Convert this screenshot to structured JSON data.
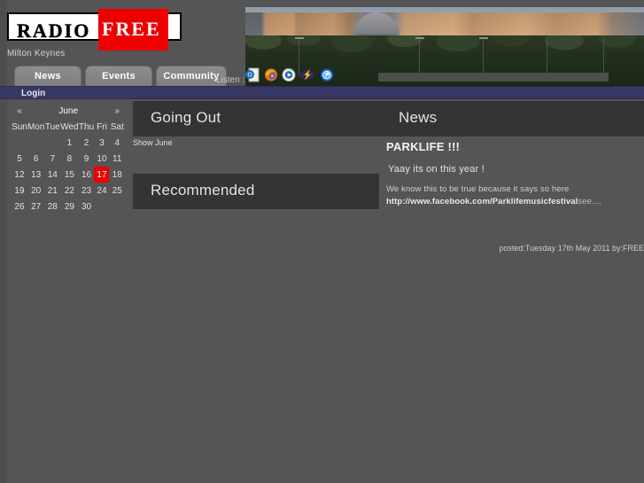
{
  "site": {
    "logo_primary": "RADIO",
    "logo_secondary": "FREE",
    "subtitle": "Milton Keynes",
    "banner_alt": "milton-keynes-skyline-photo"
  },
  "nav": {
    "tabs": [
      {
        "label": "News"
      },
      {
        "label": "Events"
      },
      {
        "label": "Community"
      }
    ],
    "listen_label": "Listen :",
    "listen_players": [
      {
        "name": "windows-media-player-icon"
      },
      {
        "name": "firefox-icon"
      },
      {
        "name": "media-player-icon"
      },
      {
        "name": "winamp-icon"
      },
      {
        "name": "realplayer-icon"
      }
    ],
    "login_label": "Login"
  },
  "calendar": {
    "prev": "«",
    "next": "»",
    "month": "June",
    "dow": [
      "Sun",
      "Mon",
      "Tue",
      "Wed",
      "Thu",
      "Fri",
      "Sat"
    ],
    "weeks": [
      [
        "",
        "",
        "",
        "1",
        "2",
        "3",
        "4"
      ],
      [
        "5",
        "6",
        "7",
        "8",
        "9",
        "10",
        "11"
      ],
      [
        "12",
        "13",
        "14",
        "15",
        "16",
        "17",
        "18"
      ],
      [
        "19",
        "20",
        "21",
        "22",
        "23",
        "24",
        "25"
      ],
      [
        "26",
        "27",
        "28",
        "29",
        "30",
        "",
        ""
      ]
    ],
    "today": "17",
    "today_color": "#ee0000"
  },
  "sections": {
    "going_out_title": "Going Out",
    "news_title": "News",
    "show_month_label": "Show June",
    "recommended_title": "Recommended"
  },
  "article": {
    "title": "PARKLIFE !!!",
    "subtitle": "Yaay its on this year !",
    "body_line1": "We know this to be true because it says so here",
    "link": "http://www.facebook.com/Parklifemusicfestival",
    "more": "see....",
    "posted": "posted:Tuesday 17th May 2011 by:FREE"
  },
  "theme": {
    "page_bg": "#555557",
    "panel_bg": "#333335",
    "login_bar_bg": "#383866",
    "accent_red": "#ee0000"
  }
}
